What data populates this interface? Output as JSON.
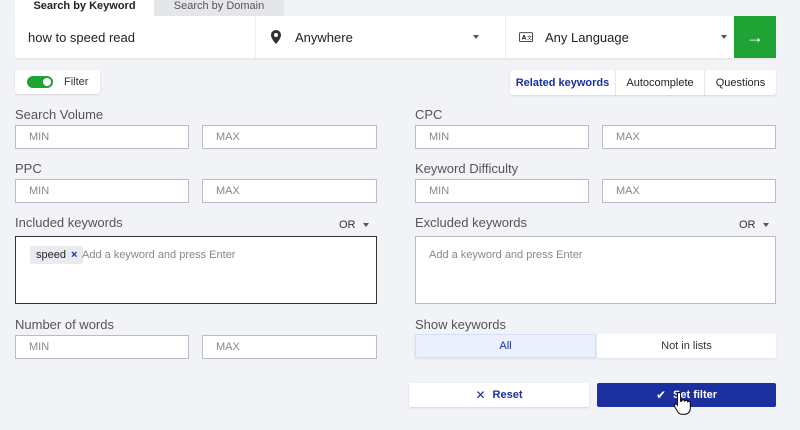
{
  "tabs": {
    "keyword": "Search by Keyword",
    "domain": "Search by Domain"
  },
  "search": {
    "query": "how to speed read",
    "location": "Anywhere",
    "language": "Any Language"
  },
  "filter_toggle": {
    "label": "Filter",
    "on": true
  },
  "mode_tabs": [
    "Related keywords",
    "Autocomplete",
    "Questions"
  ],
  "fields": {
    "search_volume": "Search Volume",
    "cpc": "CPC",
    "ppc": "PPC",
    "keyword_difficulty": "Keyword Difficulty",
    "min_placeholder": "MIN",
    "max_placeholder": "MAX"
  },
  "included": {
    "label": "Included keywords",
    "operator": "OR",
    "chips": [
      "speed"
    ],
    "placeholder": "Add a keyword and press Enter"
  },
  "excluded": {
    "label": "Excluded keywords",
    "operator": "OR",
    "placeholder": "Add a keyword and press Enter"
  },
  "number_of_words": "Number of words",
  "show_keywords": {
    "label": "Show keywords",
    "options": [
      "All",
      "Not in lists"
    ]
  },
  "buttons": {
    "reset": "Reset",
    "set_filter": "Set filter"
  },
  "colors": {
    "green": "#1fa334",
    "navy": "#1b2f9f"
  }
}
